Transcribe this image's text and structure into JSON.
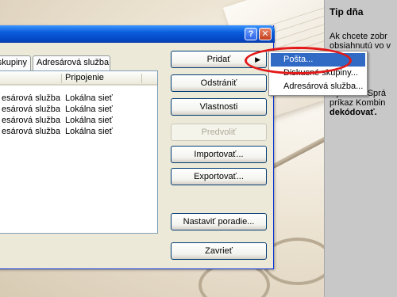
{
  "tip_panel": {
    "title": "Tip dňa",
    "lines": [
      {
        "text": "Ak chcete zobr",
        "bold": false
      },
      {
        "text": "obsiahnutú vo v",
        "bold": false
      },
      {
        "text": "",
        "bold": false
      },
      {
        "text": "",
        "bold": false
      },
      {
        "text": "",
        "bold": false
      },
      {
        "text": "",
        "bold": false
      },
      {
        "text": "v ponuke Sprá",
        "bold": false
      },
      {
        "text": "príkaz Kombin",
        "bold": false
      },
      {
        "text": "dekódovať.",
        "bold": true
      }
    ]
  },
  "dialog": {
    "help_symbol": "?",
    "close_symbol": "✕",
    "tabs": [
      "skupiny",
      "Adresárová služba"
    ],
    "list": {
      "columns": [
        "",
        "Pripojenie"
      ],
      "rows": [
        [
          "esárová služba",
          "Lokálna sieť"
        ],
        [
          "esárová služba",
          "Lokálna sieť"
        ],
        [
          "esárová služba",
          "Lokálna sieť"
        ],
        [
          "esárová služba",
          "Lokálna sieť"
        ]
      ]
    },
    "buttons": {
      "add": "Pridať",
      "add_arrow": "▶",
      "remove": "Odstrániť",
      "properties": "Vlastnosti",
      "set_default": "Predvoliť",
      "import": "Importovať...",
      "export": "Exportovať...",
      "set_order": "Nastaviť poradie...",
      "close": "Zavrieť"
    }
  },
  "submenu": {
    "items": [
      "Pošta...",
      "Diskusné skupiny...",
      "Adresárová služba..."
    ],
    "selected_index": 0
  },
  "colors": {
    "highlight": "#e31818",
    "selection": "#316ac5"
  }
}
